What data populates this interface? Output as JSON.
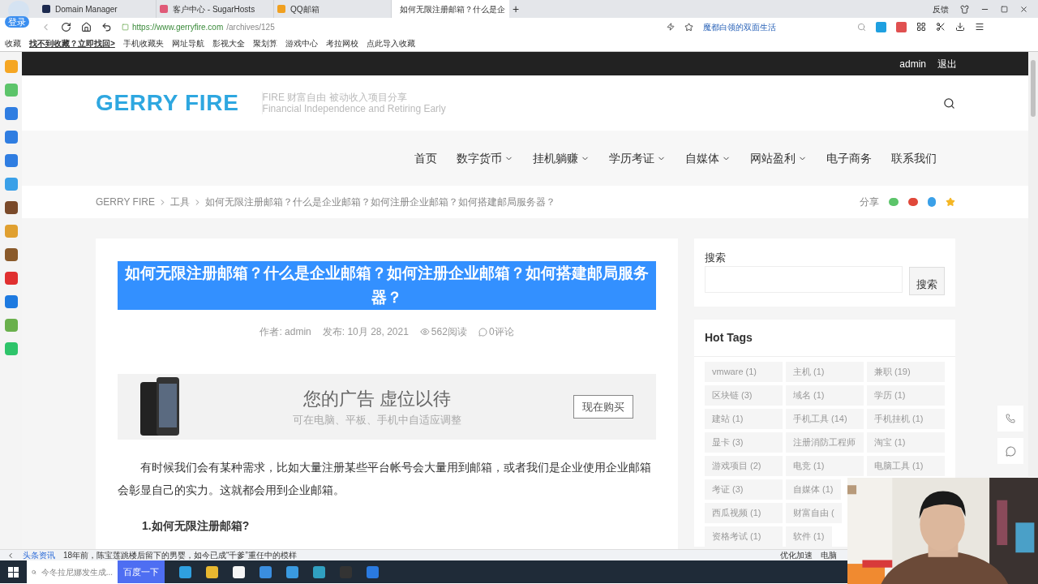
{
  "browser": {
    "login_badge": "登录",
    "tabs": [
      {
        "title": "Domain Manager",
        "selected": false
      },
      {
        "title": "客户中心 - SugarHosts",
        "selected": false
      },
      {
        "title": "QQ邮箱",
        "selected": false
      },
      {
        "title": "如何无限注册邮箱？什么是企",
        "selected": true
      }
    ],
    "new_tab": "+",
    "window_buttons": {
      "feedback": "反馈"
    },
    "url_host": "https://www.gerryfire.com",
    "url_path": "/archives/125",
    "suggest": "魔都白领的双面生活",
    "bookmarks": [
      "收藏",
      "找不到收藏？立即找回>",
      "手机收藏夹",
      "网址导航",
      "影视大全",
      "聚划算",
      "游戏中心",
      "考拉网校",
      "点此导入收藏"
    ]
  },
  "site": {
    "user": "admin",
    "logout": "退出",
    "logo": "GERRY FIRE",
    "tagline": [
      "FIRE 财富自由 被动收入项目分享",
      "Financial Independence and Retiring Early"
    ],
    "nav": [
      {
        "label": "首页",
        "has_menu": false
      },
      {
        "label": "数字货币",
        "has_menu": true
      },
      {
        "label": "挂机躺赚",
        "has_menu": true
      },
      {
        "label": "学历考证",
        "has_menu": true
      },
      {
        "label": "自媒体",
        "has_menu": true
      },
      {
        "label": "网站盈利",
        "has_menu": true
      },
      {
        "label": "电子商务",
        "has_menu": false
      },
      {
        "label": "联系我们",
        "has_menu": false
      }
    ],
    "breadcrumb": [
      "GERRY FIRE",
      "工具",
      "如何无限注册邮箱？什么是企业邮箱？如何注册企业邮箱？如何搭建邮局服务器？"
    ],
    "share_label": "分享"
  },
  "article": {
    "title": "如何无限注册邮箱？什么是企业邮箱？如何注册企业邮箱？如何搭建邮局服务器？",
    "title_selected": true,
    "author": "作者: admin",
    "date": "发布: 10月 28, 2021",
    "views": "562阅读",
    "comments": "0评论",
    "ad": {
      "headline": "您的广告 虚位以待",
      "subline": "可在电脑、平板、手机中自适应调整",
      "button": "现在购买"
    },
    "paragraph": "有时候我们会有某种需求，比如大量注册某些平台帐号会大量用到邮箱，或者我们是企业使用企业邮箱会彰显自己的实力。这就都会用到企业邮箱。",
    "heading": "1.如何无限注册邮箱?"
  },
  "sidebar": {
    "search_title": "搜索",
    "search_button": "搜索",
    "tags_title": "Hot Tags",
    "tag_rows": [
      [
        "vmware (1)",
        "主机 (1)",
        "兼职 (19)"
      ],
      [
        "区块链 (3)",
        "域名 (1)",
        "学历 (1)"
      ],
      [
        "建站 (1)",
        "手机工具 (14)",
        "手机挂机 (1)"
      ],
      [
        "显卡 (3)",
        "注册消防工程师",
        "淘宝 (1)"
      ],
      [
        "游戏项目 (2)",
        "电竞 (1)",
        "电脑工具 (1)"
      ],
      [
        "考证 (3)",
        "自媒体 (1)"
      ],
      [
        "西瓜视频 (1)",
        "财富自由 ("
      ],
      [
        "资格考试 (1)",
        "软件 (1)"
      ]
    ]
  },
  "status_bar": {
    "news_source": "头条资讯",
    "news": "18年前，陈宝莲跳楼后留下的男婴，如今已成“千爹”重任中的模样",
    "boost": "优化加速",
    "tv": "电脑"
  },
  "taskbar": {
    "search_placeholder": "今冬拉尼娜发生成...",
    "search_button": "百度一下"
  }
}
